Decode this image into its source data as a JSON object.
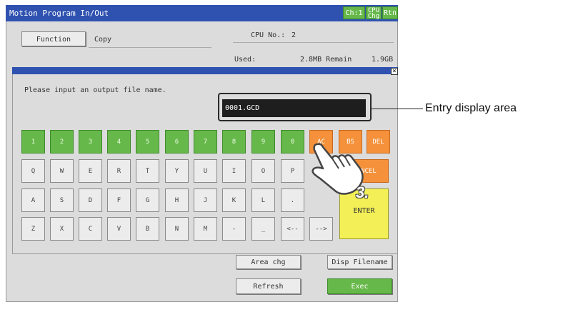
{
  "window": {
    "title": "Motion Program In/Out",
    "ch_label": "Ch:1",
    "cpu_chg_label": "CPU\nChg",
    "rtn_label": "Rtn"
  },
  "panel": {
    "function_label": "Function",
    "function_value": "Copy",
    "cpu_label": "CPU No.:",
    "cpu_value": "2",
    "used_label": "Used:",
    "remain_value": "2.8MB Remain",
    "size_value": "1.9GB"
  },
  "dialog": {
    "prompt": "Please input an output file name.",
    "entry_value": "0001.GCD",
    "close_label": "×",
    "keys_row1": [
      "1",
      "2",
      "3",
      "4",
      "5",
      "6",
      "7",
      "8",
      "9",
      "0"
    ],
    "keys_row1_func": [
      "AC",
      "BS",
      "DEL"
    ],
    "keys_row2": [
      "Q",
      "W",
      "E",
      "R",
      "T",
      "Y",
      "U",
      "I",
      "O",
      "P"
    ],
    "cancel_label": "CANCEL",
    "keys_row3": [
      "A",
      "S",
      "D",
      "F",
      "G",
      "H",
      "J",
      "K",
      "L",
      "."
    ],
    "keys_row4": [
      "Z",
      "X",
      "C",
      "V",
      "B",
      "N",
      "M",
      "-",
      "_",
      "<--",
      "-->"
    ],
    "enter_label": "ENTER"
  },
  "bottom": {
    "area_chg_label": "Area chg",
    "disp_filename_label": "Disp Filename",
    "refresh_label": "Refresh",
    "exec_label": "Exec"
  },
  "annotation": {
    "callout": "Entry display area",
    "step": "3."
  },
  "colors": {
    "title_bar": "#2f52b0",
    "green_key": "#66b84a",
    "orange_key": "#f4913a",
    "enter_key": "#f2f056"
  }
}
